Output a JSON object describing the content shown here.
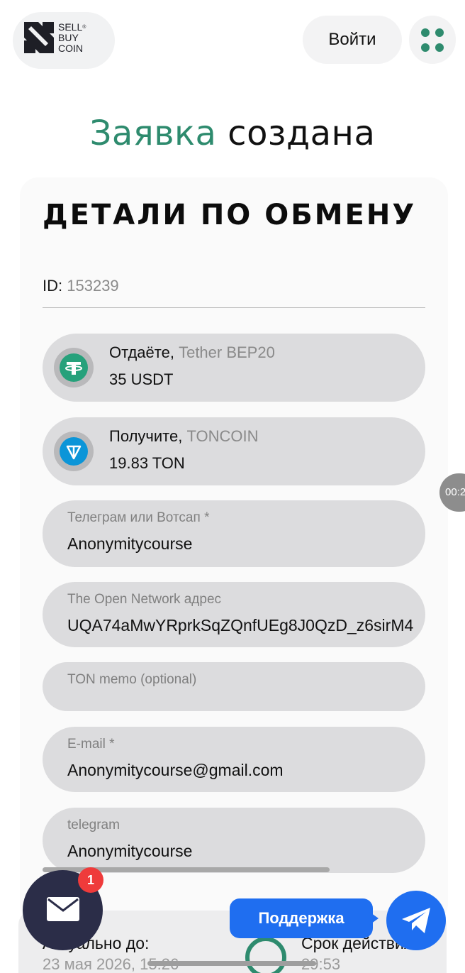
{
  "header": {
    "logo_lines": [
      "SELL",
      "BUY",
      "COIN"
    ],
    "logo_reg": "®",
    "login_label": "Войти",
    "menu_icon": "grid-dots-icon"
  },
  "title": {
    "accent": "Заявка",
    "rest": "создана"
  },
  "details": {
    "section_title": "ДЕТАЛИ ПО ОБМЕНУ",
    "id_label": "ID:",
    "id_value": "153239",
    "give": {
      "label": "Отдаёте,",
      "currency": "Tether BEP20",
      "amount": "35 USDT",
      "icon": "tether-icon"
    },
    "receive": {
      "label": "Получите,",
      "currency": "TONCOIN",
      "amount": "19.83 TON",
      "icon": "toncoin-icon"
    },
    "fields": [
      {
        "label": "Телеграм или Вотсап *",
        "value": "Anonymitycourse"
      },
      {
        "label": "The Open Network адрес",
        "value": "UQA74aMwYRprkSqZQnfUEg8J0QzD_z6sirM4"
      },
      {
        "label": "TON memo (optional)",
        "value": ""
      },
      {
        "label": "E-mail *",
        "value": "Anonymitycourse@gmail.com"
      },
      {
        "label": "telegram",
        "value": "Anonymitycourse"
      }
    ]
  },
  "timer_bubble": "00:2",
  "bottom": {
    "actual_label": "Актуально до:",
    "actual_value": "23 мая 2026, 15:26",
    "term_label": "Срок действия:",
    "term_value": "29:53"
  },
  "floating": {
    "mail_badge": "1",
    "support_label": "Поддержка"
  },
  "colors": {
    "accent": "#2e8b6e",
    "support_blue": "#1f6ef0",
    "mail_bg": "#2b2d48",
    "badge_red": "#ef3b3b"
  }
}
